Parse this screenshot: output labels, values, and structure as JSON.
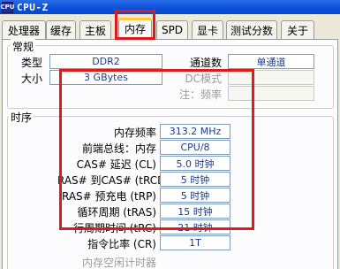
{
  "window": {
    "title": "CPU-Z",
    "icon_text": "CPU"
  },
  "tabs": [
    {
      "label": "处理器",
      "active": false
    },
    {
      "label": "缓存",
      "active": false
    },
    {
      "label": "主板",
      "active": false
    },
    {
      "label": "内存",
      "active": true
    },
    {
      "label": "SPD",
      "active": false
    },
    {
      "label": "显卡",
      "active": false
    },
    {
      "label": "测试分数",
      "active": false
    },
    {
      "label": "关于",
      "active": false
    }
  ],
  "general": {
    "title": "常规",
    "type_label": "类型",
    "type_value": "DDR2",
    "size_label": "大小",
    "size_value": "3 GBytes",
    "channels_label": "通道数",
    "channels_value": "单通道",
    "dc_mode_label": "DC模式",
    "dc_mode_value": "",
    "nb_freq_label": "注：频率",
    "nb_freq_value": ""
  },
  "timings": {
    "title": "时序",
    "rows": [
      {
        "label": "内存频率",
        "value": "313.2 MHz"
      },
      {
        "label": "前端总线：内存",
        "value": "CPU/8"
      },
      {
        "label": "CAS# 延迟 (CL)",
        "value": "5.0 时钟"
      },
      {
        "label": "RAS# 到CAS# (tRCD)",
        "value": "5 时钟"
      },
      {
        "label": "RAS# 预充电 (tRP)",
        "value": "5 时钟"
      },
      {
        "label": "循环周期 (tRAS)",
        "value": "15 时钟"
      },
      {
        "label": "行周期时间 (tRC)",
        "value": "21 时钟"
      },
      {
        "label": "指令比率 (CR)",
        "value": "1T"
      }
    ],
    "partial_row_label": "内存空闲计时器"
  },
  "annotation_color": "#e01a1a"
}
